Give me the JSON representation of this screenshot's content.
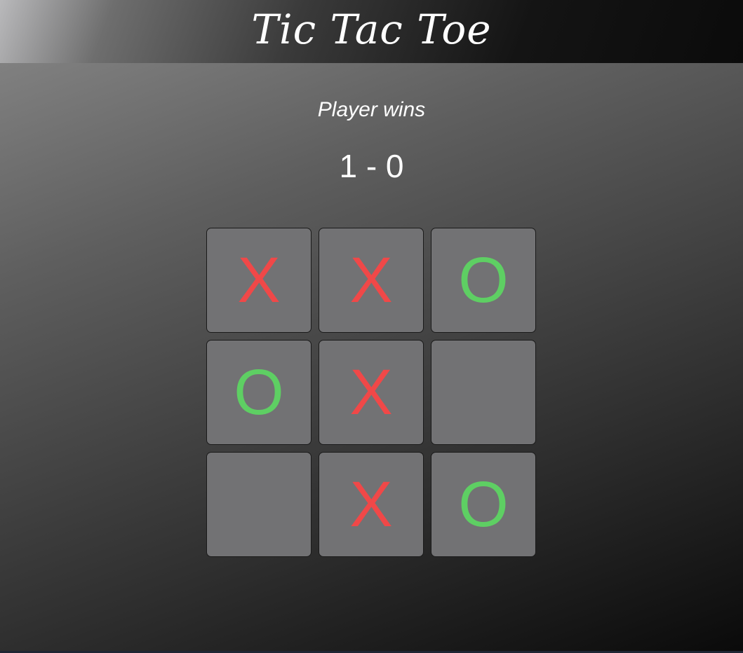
{
  "header": {
    "title": "Tic Tac Toe"
  },
  "status": {
    "text": "Player wins"
  },
  "score": {
    "text": "1 - 0",
    "player": 1,
    "computer": 0
  },
  "colors": {
    "x": "#f04848",
    "o": "#5ecf63",
    "cell": "#727274"
  },
  "board": {
    "cells": [
      {
        "mark": "X"
      },
      {
        "mark": "X"
      },
      {
        "mark": "O"
      },
      {
        "mark": "O"
      },
      {
        "mark": "X"
      },
      {
        "mark": ""
      },
      {
        "mark": ""
      },
      {
        "mark": "X"
      },
      {
        "mark": "O"
      }
    ]
  }
}
